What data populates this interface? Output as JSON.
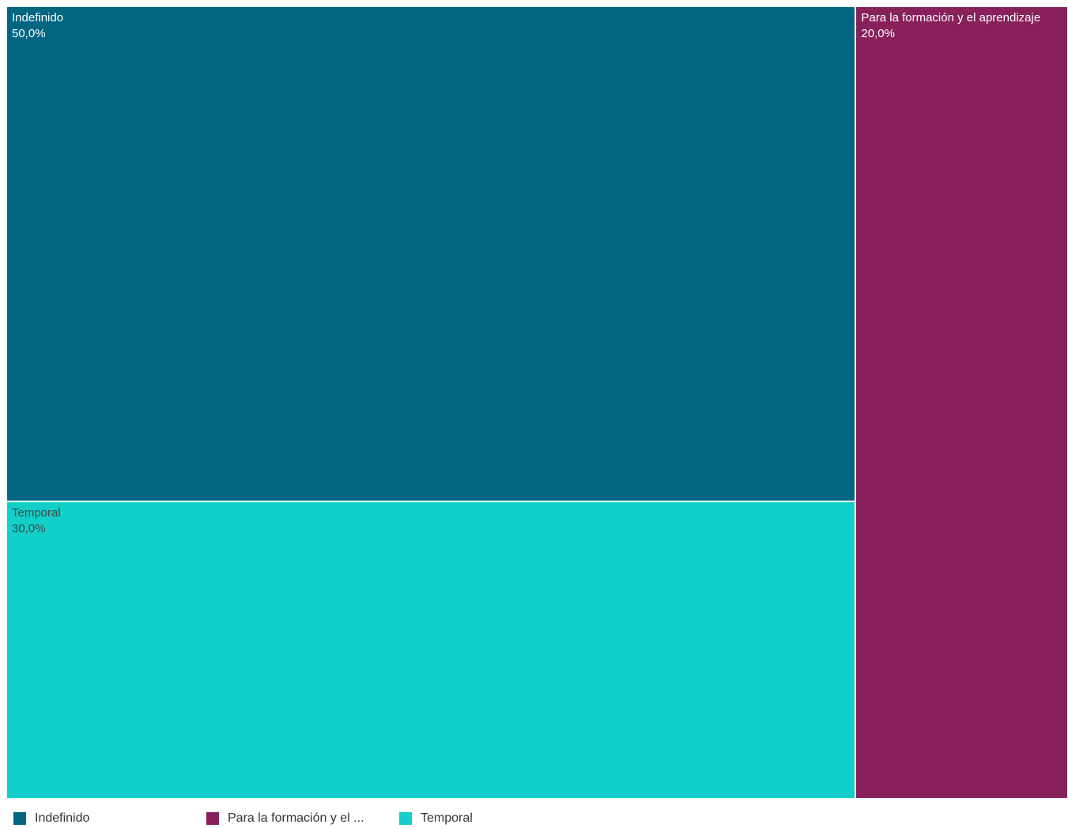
{
  "chart_data": {
    "type": "treemap",
    "items": [
      {
        "name": "Indefinido",
        "value": 50.0,
        "label_value": "50,0%",
        "color": "#006682"
      },
      {
        "name": "Temporal",
        "value": 30.0,
        "label_value": "30,0%",
        "color": "#12cfc9"
      },
      {
        "name": "Para la formación y el aprendizaje",
        "value": 20.0,
        "label_value": "20,0%",
        "color": "#88205c"
      }
    ],
    "legend": [
      {
        "name": "Indefinido",
        "label": "Indefinido",
        "color": "#006682"
      },
      {
        "name": "Para la formación y el aprendizaje",
        "label": "Para la formación y el ...",
        "color": "#88205c"
      },
      {
        "name": "Temporal",
        "label": "Temporal",
        "color": "#12cfc9"
      }
    ],
    "label_colors": {
      "dark_tile_text": "#ffffff",
      "light_tile_text": "#3a4a4a"
    }
  }
}
